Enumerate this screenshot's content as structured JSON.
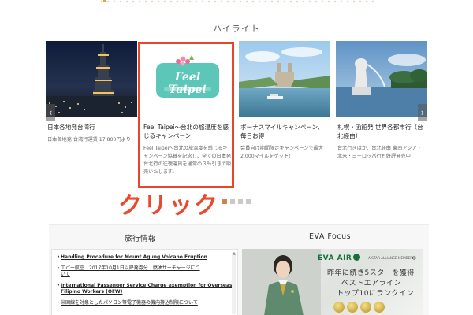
{
  "header": {
    "top_link_label": "",
    "top_link_icon": "arrow-right-icon"
  },
  "highlight": {
    "section_title": "ハイライト",
    "cards": [
      {
        "title": "日本各地発台湾行",
        "desc": "日本各地発 台湾行運賃 17,800円より",
        "image": "taipei-101-night-photo"
      },
      {
        "title": "Feel Taipei～台北の旅温度を感じるキャンペーン",
        "desc": "Feel Taipei～台北の旅温度を感じるキャンペーン協賛を記念し、全ての日本発台北行の往復運賃を通常の３％引きで販売いたします。",
        "image": "feel-taipei-logo",
        "logo_text": "Feel Taipei",
        "logo_sub": "台北の旅温度を感じる"
      },
      {
        "title": "ボーナスマイルキャンペーン、毎日お得",
        "desc": "会員向け期間限定キャンペーンで最大2,000マイルをゲット！",
        "image": "paris-seine-photo"
      },
      {
        "title": "札幌・函館発 世界各都市行（台北経由）",
        "desc": "台北行きはか、台北経由 東南アジア・北米・ヨーロッパ行も好評発売中！",
        "image": "singapore-merlion-photo"
      }
    ],
    "prev_arrow": "‹",
    "next_arrow": "›",
    "pager_count": 4,
    "pager_active": 0
  },
  "annotation": {
    "click_label": "クリック",
    "color": "#ea4a2c"
  },
  "travel_info": {
    "title": "旅行情報",
    "items": [
      {
        "text": "Handling Procedure for Mount Agung Volcano Eruption",
        "bold": true
      },
      {
        "text": "エバー航空　2017年10月1日以降発券分　燃油サーチャージにつ",
        "text2": "いて",
        "bold": false
      },
      {
        "text": "International Passenger Service Charge exemption for Overseas",
        "text2": "Filipino Workers (OFW)",
        "bold": true
      },
      {
        "text": "米国線を対象としたパソコン等電子機器の機内持込制限について",
        "bold": false
      }
    ]
  },
  "eva_focus": {
    "title": "EVA Focus",
    "logo_text": "EVA AIR",
    "alliance_text": "A STAR ALLIANCE MEMBER",
    "line1": "昨年に続き5スターを獲得",
    "line2": "ベストエアライン",
    "line3": "トップ10にランクイン",
    "brand_color": "#1a6e3c"
  }
}
